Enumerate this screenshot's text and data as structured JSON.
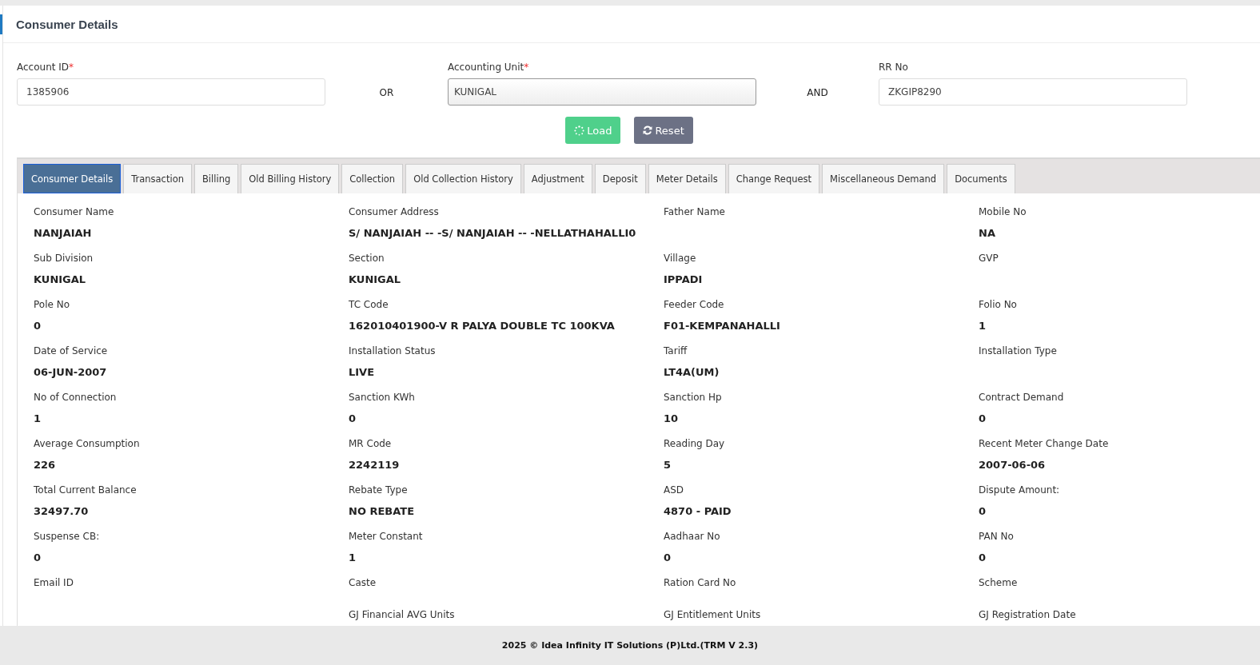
{
  "header": {
    "title": "Consumer Details"
  },
  "form": {
    "fields": [
      {
        "label": "Account ID",
        "required_mark": "*",
        "value": "1385906",
        "kind": "input"
      },
      {
        "connector": "OR"
      },
      {
        "label": "Accounting Unit",
        "required_mark": "*",
        "value": "KUNIGAL",
        "kind": "select"
      },
      {
        "connector": "AND"
      },
      {
        "label": "RR No",
        "value": "ZKGIP8290",
        "kind": "input"
      }
    ],
    "buttons": [
      {
        "label": "Load",
        "kind": "load"
      },
      {
        "label": "Reset",
        "kind": "reset"
      }
    ]
  },
  "tabs": [
    {
      "label": "Consumer Details",
      "selected": true
    },
    {
      "label": "Transaction",
      "selected": false
    },
    {
      "label": "Billing",
      "selected": false
    },
    {
      "label": "Old Billing History",
      "selected": false
    },
    {
      "label": "Collection",
      "selected": false
    },
    {
      "label": "Old Collection History",
      "selected": false
    },
    {
      "label": "Adjustment",
      "selected": false
    },
    {
      "label": "Deposit",
      "selected": false
    },
    {
      "label": "Meter Details",
      "selected": false
    },
    {
      "label": "Change Request",
      "selected": false
    },
    {
      "label": "Miscellaneous Demand",
      "selected": false
    },
    {
      "label": "Documents",
      "selected": false
    }
  ],
  "details": [
    [
      {
        "kind": "field",
        "label": "Consumer Name",
        "value": "NANJAIAH"
      },
      {
        "kind": "field",
        "label": "Consumer Address",
        "value": "S/ NANJAIAH -- -S/ NANJAIAH -- -NELLATHAHALLI0"
      },
      {
        "kind": "field",
        "label": "Father Name"
      },
      {
        "kind": "field",
        "label": "Mobile No",
        "value": "NA"
      }
    ],
    [
      {
        "kind": "field",
        "label": "Sub Division",
        "value": "KUNIGAL"
      },
      {
        "kind": "field",
        "label": "Section",
        "value": "KUNIGAL"
      },
      {
        "kind": "field",
        "label": "Village",
        "value": "IPPADI"
      },
      {
        "kind": "field",
        "label": "GVP"
      }
    ],
    [
      {
        "kind": "field",
        "label": "Pole No",
        "value": "0"
      },
      {
        "kind": "field",
        "label": "TC Code",
        "value": "162010401900-V R PALYA DOUBLE TC 100KVA"
      },
      {
        "kind": "field",
        "label": "Feeder Code",
        "value": "F01-KEMPANAHALLI"
      },
      {
        "kind": "field",
        "label": "Folio No",
        "value": "1"
      }
    ],
    [
      {
        "kind": "field",
        "label": "Date of Service",
        "value": "06-JUN-2007"
      },
      {
        "kind": "field",
        "label": "Installation Status",
        "value": "LIVE"
      },
      {
        "kind": "field",
        "label": "Tariff",
        "value": "LT4A(UM)"
      },
      {
        "kind": "field",
        "label": "Installation Type"
      }
    ],
    [
      {
        "kind": "field",
        "label": "No of Connection",
        "value": "1"
      },
      {
        "kind": "field",
        "label": "Sanction KWh",
        "value": "0"
      },
      {
        "kind": "field",
        "label": "Sanction Hp",
        "value": "10"
      },
      {
        "kind": "field",
        "label": "Contract Demand",
        "value": "0"
      }
    ],
    [
      {
        "kind": "field",
        "label": "Average Consumption",
        "value": "226"
      },
      {
        "kind": "field",
        "label": "MR Code",
        "value": "2242119"
      },
      {
        "kind": "field",
        "label": "Reading Day",
        "value": "5"
      },
      {
        "kind": "field",
        "label": "Recent Meter Change Date",
        "value": "2007-06-06"
      }
    ],
    [
      {
        "kind": "field",
        "label": "Total Current Balance",
        "value": "32497.70"
      },
      {
        "kind": "field",
        "label": "Rebate Type",
        "value": "NO REBATE"
      },
      {
        "kind": "field",
        "label": "ASD",
        "value": "4870 - PAID"
      },
      {
        "kind": "field",
        "label": "Dispute Amount:",
        "value": "0"
      }
    ],
    [
      {
        "kind": "field",
        "label": "Suspense CB:",
        "value": "0"
      },
      {
        "kind": "field",
        "label": "Meter Constant",
        "value": "1"
      },
      {
        "kind": "field",
        "label": "Aadhaar No",
        "value": "0"
      },
      {
        "kind": "field",
        "label": "PAN No",
        "value": "0"
      }
    ],
    [
      {
        "kind": "field",
        "label": "Email ID"
      },
      {
        "kind": "field",
        "label": "Caste"
      },
      {
        "kind": "field",
        "label": "Ration Card No"
      },
      {
        "kind": "field",
        "label": "Scheme"
      }
    ],
    [
      {
        "kind": "blank"
      },
      {
        "kind": "field",
        "label": "GJ Financial AVG Units"
      },
      {
        "kind": "field",
        "label": "GJ Entitlement Units"
      },
      {
        "kind": "field",
        "label": "GJ Registration Date"
      }
    ]
  ],
  "footer": {
    "text": "2025 © Idea Infinity IT Solutions (P)Ltd.(TRM V 2.3)"
  }
}
